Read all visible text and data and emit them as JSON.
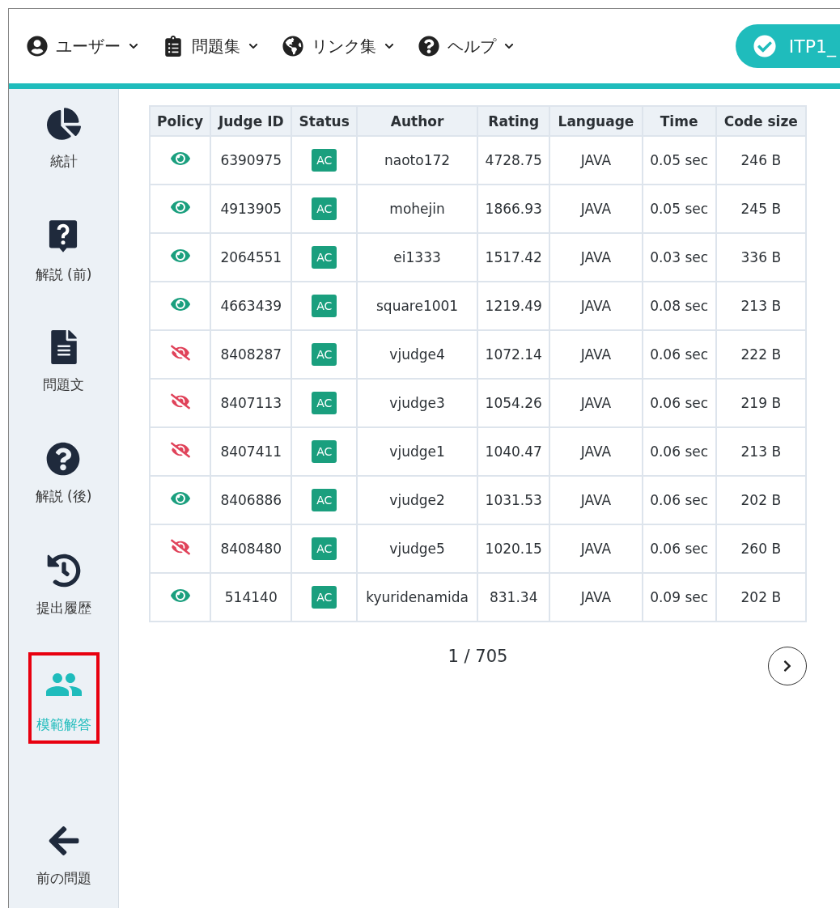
{
  "nav": {
    "menus": [
      {
        "label": "ユーザー",
        "kind": "user"
      },
      {
        "label": "問題集",
        "kind": "clipboard"
      },
      {
        "label": "リンク集",
        "kind": "globe"
      },
      {
        "label": "ヘルプ",
        "kind": "help"
      }
    ],
    "problem_chip": "ITP1_"
  },
  "sidebar": {
    "items": [
      {
        "label": "統計",
        "kind": "stats",
        "selected": false
      },
      {
        "label": "解説 (前)",
        "kind": "hint",
        "selected": false
      },
      {
        "label": "問題文",
        "kind": "document",
        "selected": false
      },
      {
        "label": "解説 (後)",
        "kind": "commentary",
        "selected": false
      },
      {
        "label": "提出履歴",
        "kind": "history",
        "selected": false
      },
      {
        "label": "模範解答",
        "kind": "solutions",
        "selected": true
      },
      {
        "label": "前の問題",
        "kind": "back",
        "selected": false
      }
    ]
  },
  "table": {
    "columns": [
      "Policy",
      "Judge ID",
      "Status",
      "Author",
      "Rating",
      "Language",
      "Time",
      "Code size"
    ],
    "rows": [
      {
        "public": true,
        "judge_id": "6390975",
        "status": "AC",
        "author": "naoto172",
        "rating": "4728.75",
        "language": "JAVA",
        "time": "0.05 sec",
        "code_size": "246 B"
      },
      {
        "public": true,
        "judge_id": "4913905",
        "status": "AC",
        "author": "mohejin",
        "rating": "1866.93",
        "language": "JAVA",
        "time": "0.05 sec",
        "code_size": "245 B"
      },
      {
        "public": true,
        "judge_id": "2064551",
        "status": "AC",
        "author": "ei1333",
        "rating": "1517.42",
        "language": "JAVA",
        "time": "0.03 sec",
        "code_size": "336 B"
      },
      {
        "public": true,
        "judge_id": "4663439",
        "status": "AC",
        "author": "square1001",
        "rating": "1219.49",
        "language": "JAVA",
        "time": "0.08 sec",
        "code_size": "213 B"
      },
      {
        "public": false,
        "judge_id": "8408287",
        "status": "AC",
        "author": "vjudge4",
        "rating": "1072.14",
        "language": "JAVA",
        "time": "0.06 sec",
        "code_size": "222 B"
      },
      {
        "public": false,
        "judge_id": "8407113",
        "status": "AC",
        "author": "vjudge3",
        "rating": "1054.26",
        "language": "JAVA",
        "time": "0.06 sec",
        "code_size": "219 B"
      },
      {
        "public": false,
        "judge_id": "8407411",
        "status": "AC",
        "author": "vjudge1",
        "rating": "1040.47",
        "language": "JAVA",
        "time": "0.06 sec",
        "code_size": "213 B"
      },
      {
        "public": true,
        "judge_id": "8406886",
        "status": "AC",
        "author": "vjudge2",
        "rating": "1031.53",
        "language": "JAVA",
        "time": "0.06 sec",
        "code_size": "202 B"
      },
      {
        "public": false,
        "judge_id": "8408480",
        "status": "AC",
        "author": "vjudge5",
        "rating": "1020.15",
        "language": "JAVA",
        "time": "0.06 sec",
        "code_size": "260 B"
      },
      {
        "public": true,
        "judge_id": "514140",
        "status": "AC",
        "author": "kyuridenamida",
        "rating": "831.34",
        "language": "JAVA",
        "time": "0.09 sec",
        "code_size": "202 B"
      }
    ]
  },
  "pagination": {
    "page": "1 / 705"
  }
}
